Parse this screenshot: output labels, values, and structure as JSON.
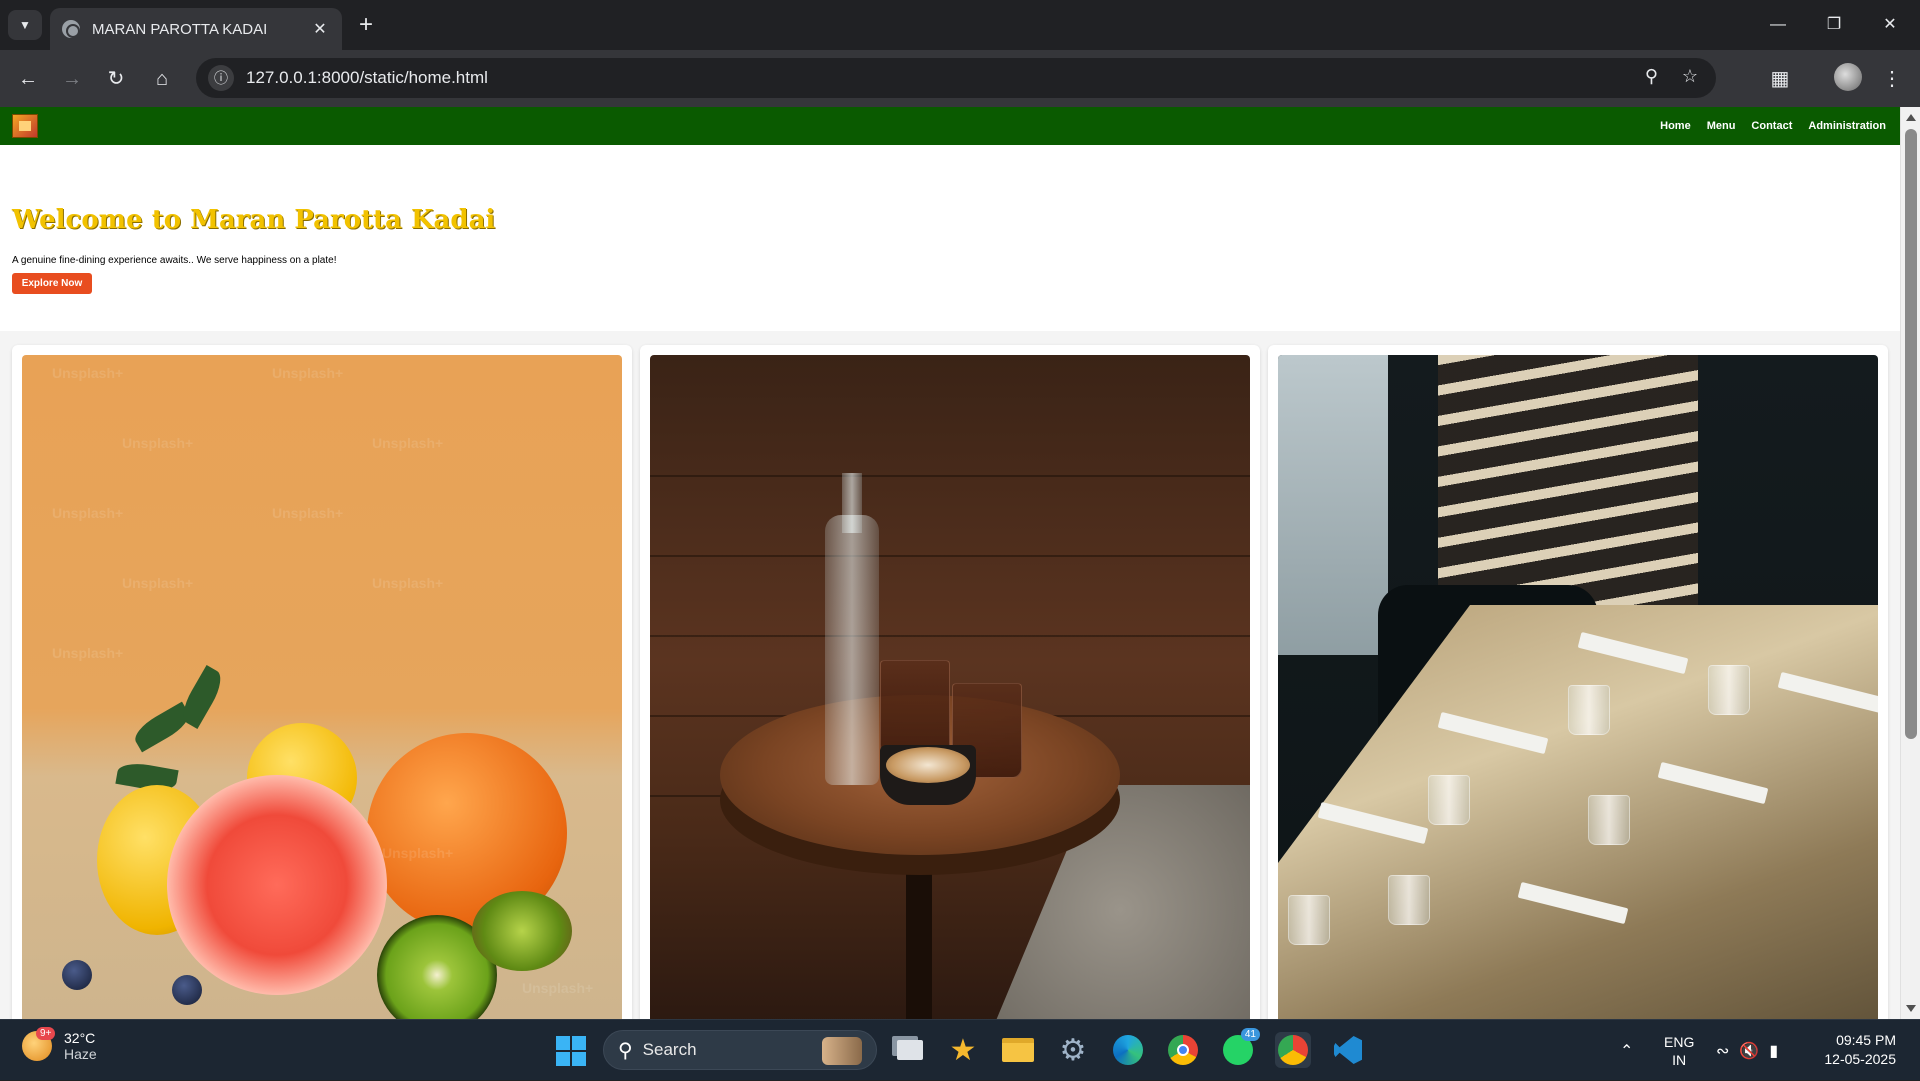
{
  "browser": {
    "tab_title": "MARAN PAROTTA KADAI",
    "url": "127.0.0.1:8000/static/home.html"
  },
  "site": {
    "nav": [
      "Home",
      "Menu",
      "Contact",
      "Administration"
    ],
    "hero_title": "Welcome to Maran Parotta Kadai",
    "hero_subtitle": "A genuine fine-dining experience awaits.. We serve happiness on a plate!",
    "explore_label": "Explore Now",
    "watermark": "Unsplash+"
  },
  "taskbar": {
    "weather_temp": "32°C",
    "weather_desc": "Haze",
    "weather_badge": "9+",
    "search_label": "Search",
    "whatsapp_badge": "41",
    "lang_top": "ENG",
    "lang_bottom": "IN",
    "time": "09:45 PM",
    "date": "12-05-2025"
  },
  "colors": {
    "navbar": "#0a5a00",
    "title_gold": "#f2c200",
    "button_orange": "#e84d1f"
  }
}
